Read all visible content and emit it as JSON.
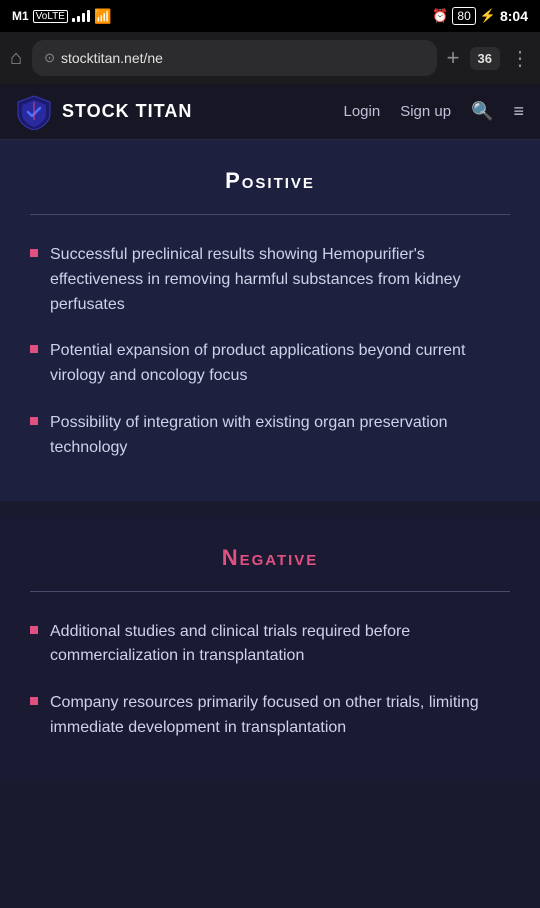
{
  "status_bar": {
    "carrier": "M1",
    "volte": "VoLTE",
    "signal_bars": 4,
    "wifi": "wifi",
    "alarm": "alarm",
    "battery": "80",
    "charging": true,
    "time": "8:04"
  },
  "browser": {
    "url": "stocktitan.net/ne",
    "tabs_count": "36",
    "home_label": "⌂",
    "new_tab_label": "+",
    "more_label": "⋮"
  },
  "nav": {
    "logo_text": "STOCK TITAN",
    "login_label": "Login",
    "signup_label": "Sign up",
    "search_title": "search",
    "menu_title": "menu"
  },
  "positive_section": {
    "title": "Positive",
    "items": [
      "Successful preclinical results showing Hemopurifier's effectiveness in removing harmful substances from kidney perfusates",
      "Potential expansion of product applications beyond current virology and oncology focus",
      "Possibility of integration with existing organ preservation technology"
    ]
  },
  "negative_section": {
    "title": "Negative",
    "items": [
      "Additional studies and clinical trials required before commercialization in transplantation",
      "Company resources primarily focused on other trials, limiting immediate development in transplantation"
    ]
  }
}
